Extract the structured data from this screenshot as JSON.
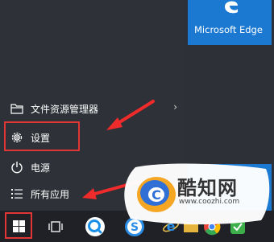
{
  "tiles": {
    "edge_label": "Microsoft Edge"
  },
  "start_menu": {
    "items": [
      {
        "label": "文件资源管理器",
        "icon": "folder-icon"
      },
      {
        "label": "设置",
        "icon": "gear-icon"
      },
      {
        "label": "电源",
        "icon": "power-icon"
      },
      {
        "label": "所有应用",
        "icon": "list-icon"
      }
    ]
  },
  "taskbar": {
    "items": [
      {
        "icon": "windows-start-icon"
      },
      {
        "icon": "task-view-icon"
      },
      {
        "icon": "search-circle-icon"
      },
      {
        "icon": "sogou-s-icon"
      },
      {
        "icon": "internet-explorer-icon"
      },
      {
        "icon": "folder-icon"
      },
      {
        "icon": "chrome-icon"
      },
      {
        "icon": "green-app-icon"
      }
    ]
  },
  "watermark": {
    "brand": "酷知网",
    "url": "www.coozhi.com"
  },
  "colors": {
    "highlight": "#e23535",
    "tile_blue": "#1c79d2",
    "background": "#2d3036"
  }
}
